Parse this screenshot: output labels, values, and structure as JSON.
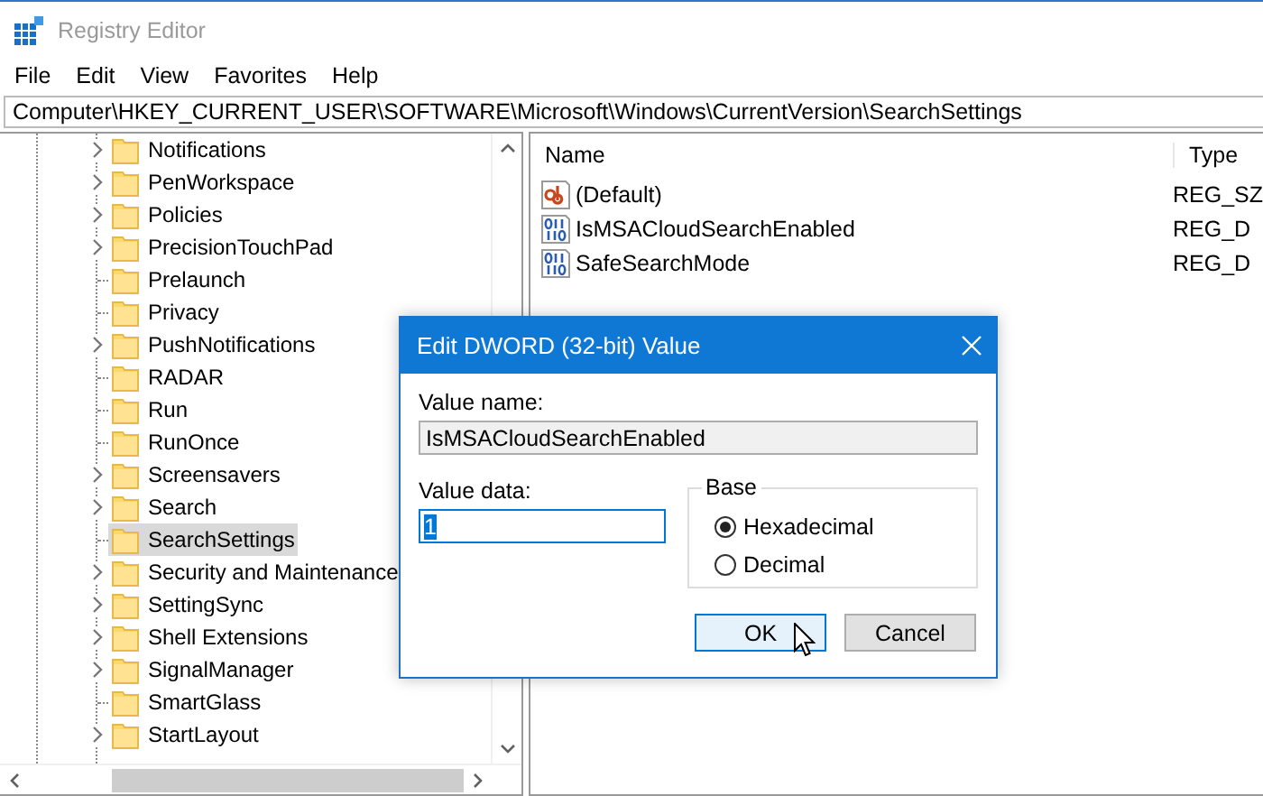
{
  "window": {
    "title": "Registry Editor"
  },
  "menu": [
    "File",
    "Edit",
    "View",
    "Favorites",
    "Help"
  ],
  "address": "Computer\\HKEY_CURRENT_USER\\SOFTWARE\\Microsoft\\Windows\\CurrentVersion\\SearchSettings",
  "tree": {
    "items": [
      {
        "label": "Notifications",
        "expandable": true,
        "selected": false
      },
      {
        "label": "PenWorkspace",
        "expandable": true,
        "selected": false
      },
      {
        "label": "Policies",
        "expandable": true,
        "selected": false
      },
      {
        "label": "PrecisionTouchPad",
        "expandable": true,
        "selected": false
      },
      {
        "label": "Prelaunch",
        "expandable": false,
        "selected": false
      },
      {
        "label": "Privacy",
        "expandable": false,
        "selected": false
      },
      {
        "label": "PushNotifications",
        "expandable": true,
        "selected": false
      },
      {
        "label": "RADAR",
        "expandable": false,
        "selected": false
      },
      {
        "label": "Run",
        "expandable": false,
        "selected": false
      },
      {
        "label": "RunOnce",
        "expandable": false,
        "selected": false
      },
      {
        "label": "Screensavers",
        "expandable": true,
        "selected": false
      },
      {
        "label": "Search",
        "expandable": true,
        "selected": false
      },
      {
        "label": "SearchSettings",
        "expandable": false,
        "selected": true
      },
      {
        "label": "Security and Maintenance",
        "expandable": true,
        "selected": false
      },
      {
        "label": "SettingSync",
        "expandable": true,
        "selected": false
      },
      {
        "label": "Shell Extensions",
        "expandable": true,
        "selected": false
      },
      {
        "label": "SignalManager",
        "expandable": true,
        "selected": false
      },
      {
        "label": "SmartGlass",
        "expandable": false,
        "selected": false
      },
      {
        "label": "StartLayout",
        "expandable": true,
        "selected": false
      }
    ]
  },
  "values": {
    "columns": [
      "Name",
      "Type"
    ],
    "rows": [
      {
        "kind": "string",
        "name": "(Default)",
        "type": "REG_SZ"
      },
      {
        "kind": "dword",
        "name": "IsMSACloudSearchEnabled",
        "type": "REG_D"
      },
      {
        "kind": "dword",
        "name": "SafeSearchMode",
        "type": "REG_D"
      }
    ]
  },
  "dialog": {
    "title": "Edit DWORD (32-bit) Value",
    "value_name_label": "Value name:",
    "value_name": "IsMSACloudSearchEnabled",
    "value_data_label": "Value data:",
    "value_data": "1",
    "value_data_selected": true,
    "base_label": "Base",
    "radios": [
      {
        "label": "Hexadecimal",
        "selected": true
      },
      {
        "label": "Decimal",
        "selected": false
      }
    ],
    "buttons": [
      {
        "label": "OK",
        "focused": true
      },
      {
        "label": "Cancel",
        "focused": false
      }
    ]
  }
}
